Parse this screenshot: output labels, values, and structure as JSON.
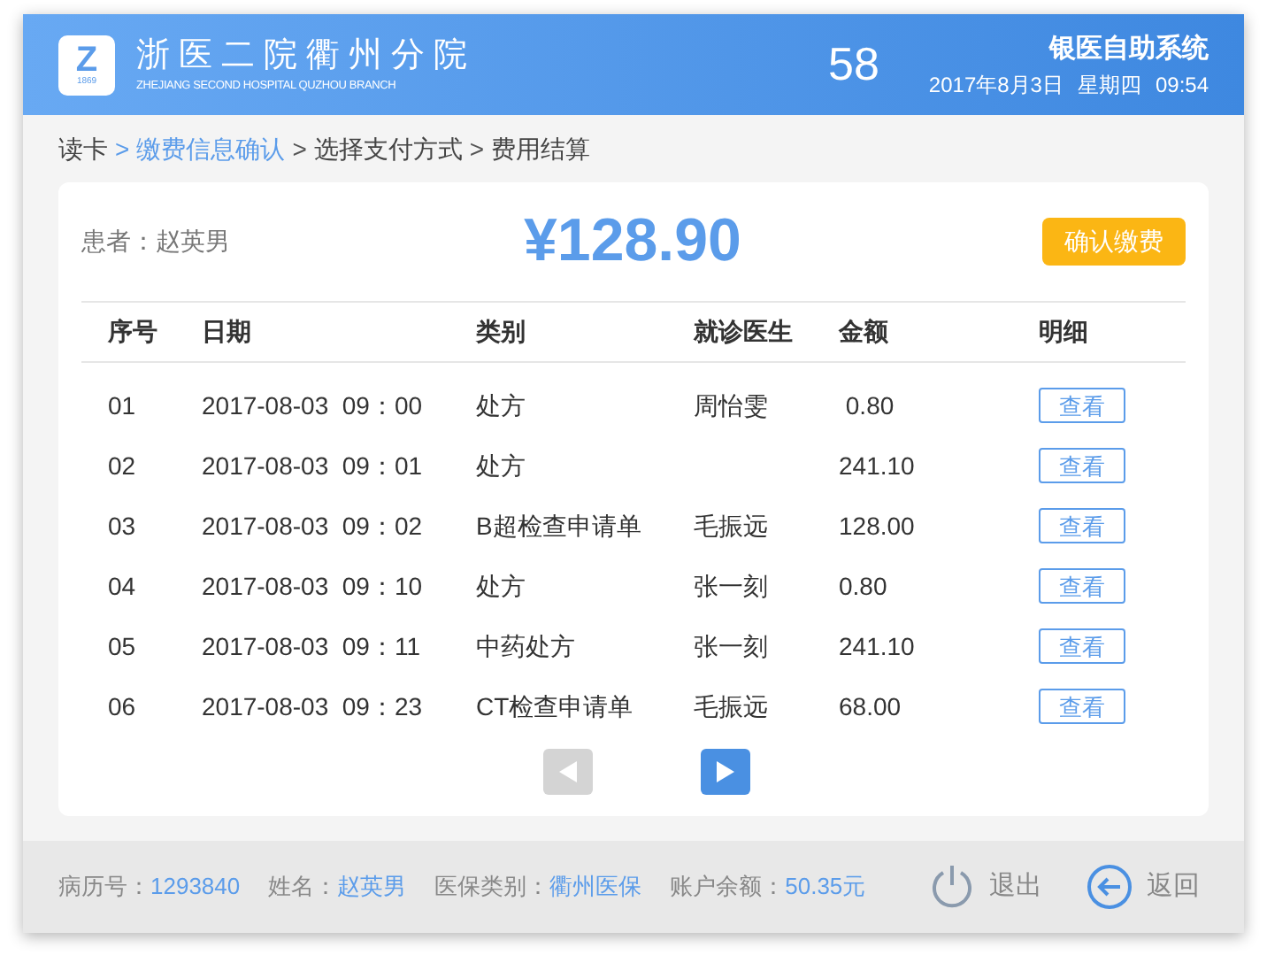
{
  "header": {
    "logo": {
      "letter": "Z",
      "year": "1869"
    },
    "title": "浙医二院衢州分院",
    "subtitle": "ZHEJIANG SECOND HOSPITAL QUZHOU BRANCH",
    "countdown": "58",
    "system": "银医自助系统",
    "date": "2017年8月3日",
    "weekday": "星期四",
    "time": "09:54"
  },
  "breadcrumb": [
    {
      "label": "读卡",
      "selected": false
    },
    {
      "label": "缴费信息确认",
      "selected": true
    },
    {
      "label": "选择支付方式",
      "selected": false
    },
    {
      "label": "费用结算",
      "selected": false
    }
  ],
  "separator": ">",
  "summary": {
    "patient": "患者：赵英男",
    "total": "¥128.90",
    "confirm_button": "确认缴费"
  },
  "table": {
    "columns": [
      "序号",
      "日期",
      "类别",
      "就诊医生",
      "金额",
      "明细"
    ],
    "rows": [
      {
        "no": "01",
        "date": "2017-08-03  09：00",
        "type": "处方",
        "doctor": "周怡雯",
        "amount": " 0.80",
        "action": "查看"
      },
      {
        "no": "02",
        "date": "2017-08-03  09：01",
        "type": "处方",
        "doctor": "",
        "amount": "241.10",
        "action": "查看"
      },
      {
        "no": "03",
        "date": "2017-08-03  09：02",
        "type": "B超检查申请单",
        "doctor": "毛振远",
        "amount": "128.00",
        "action": "查看"
      },
      {
        "no": "04",
        "date": "2017-08-03  09：10",
        "type": "处方",
        "doctor": "张一刻",
        "amount": "0.80",
        "action": "查看"
      },
      {
        "no": "05",
        "date": "2017-08-03  09：11",
        "type": "中药处方",
        "doctor": "张一刻",
        "amount": "241.10",
        "action": "查看"
      },
      {
        "no": "06",
        "date": "2017-08-03  09：23",
        "type": "CT检查申请单",
        "doctor": "毛振远",
        "amount": "68.00",
        "action": "查看"
      }
    ]
  },
  "pagination": {
    "prev": {
      "disabled": true
    },
    "next": {
      "disabled": false
    }
  },
  "footer": {
    "info": [
      {
        "label": "病历号：",
        "value": "1293840"
      },
      {
        "label": "姓名：",
        "value": "赵英男"
      },
      {
        "label": "医保类别：",
        "value": "衢州医保"
      },
      {
        "label": "账户余额：",
        "value": "50.35元"
      }
    ],
    "buttons": [
      {
        "kind": "exit",
        "label": "退出"
      },
      {
        "kind": "back",
        "label": "返回"
      }
    ]
  }
}
